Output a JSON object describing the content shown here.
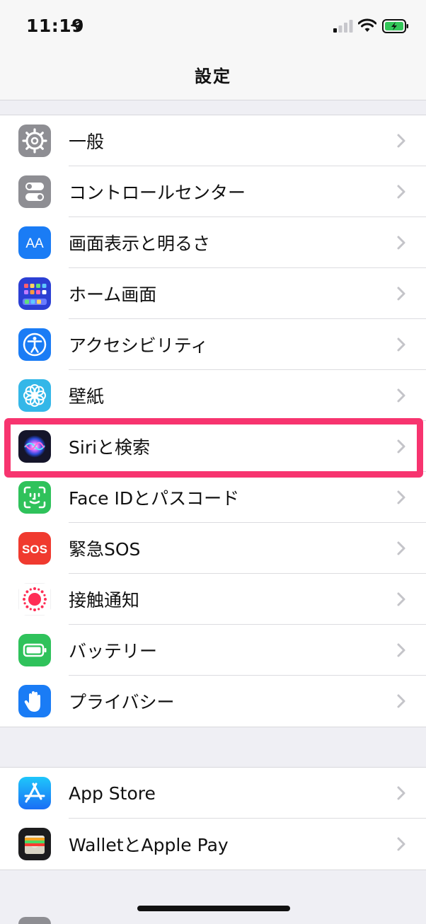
{
  "status_bar": {
    "time": "11:19",
    "icons": [
      "location-arrow-icon",
      "cellular-signal-icon",
      "wifi-icon",
      "battery-charging-icon"
    ]
  },
  "nav": {
    "title": "設定"
  },
  "groups": [
    {
      "items": [
        {
          "label": "一般",
          "icon": "gear-icon",
          "color": "#8e8e93"
        },
        {
          "label": "コントロールセンター",
          "icon": "toggles-icon",
          "color": "#8e8e93"
        },
        {
          "label": "画面表示と明るさ",
          "icon": "text-size-icon",
          "color": "#1a7cf5"
        },
        {
          "label": "ホーム画面",
          "icon": "home-screen-grid-icon",
          "color": "#2b3fd4"
        },
        {
          "label": "アクセシビリティ",
          "icon": "accessibility-icon",
          "color": "#1a7cf5"
        },
        {
          "label": "壁紙",
          "icon": "flower-icon",
          "color": "#34b7e8"
        },
        {
          "label": "Siriと検索",
          "icon": "siri-icon",
          "color": "#1b1b2f"
        },
        {
          "label": "Face IDとパスコード",
          "icon": "face-id-icon",
          "color": "#2fc25b"
        },
        {
          "label": "緊急SOS",
          "icon": "sos-icon",
          "color": "#f03a2f",
          "icon_text": "SOS"
        },
        {
          "label": "接触通知",
          "icon": "exposure-notification-icon",
          "color": "#ffffff"
        },
        {
          "label": "バッテリー",
          "icon": "battery-icon",
          "color": "#2fc25b"
        },
        {
          "label": "プライバシー",
          "icon": "hand-icon",
          "color": "#1a7cf5"
        }
      ]
    },
    {
      "items": [
        {
          "label": "App Store",
          "icon": "app-store-icon",
          "color": "#1a8cf5"
        },
        {
          "label": "WalletとApple Pay",
          "icon": "wallet-icon",
          "color": "#1c1c1e"
        }
      ]
    }
  ],
  "highlight": {
    "target": "Siriと検索",
    "color": "#f7346f"
  }
}
